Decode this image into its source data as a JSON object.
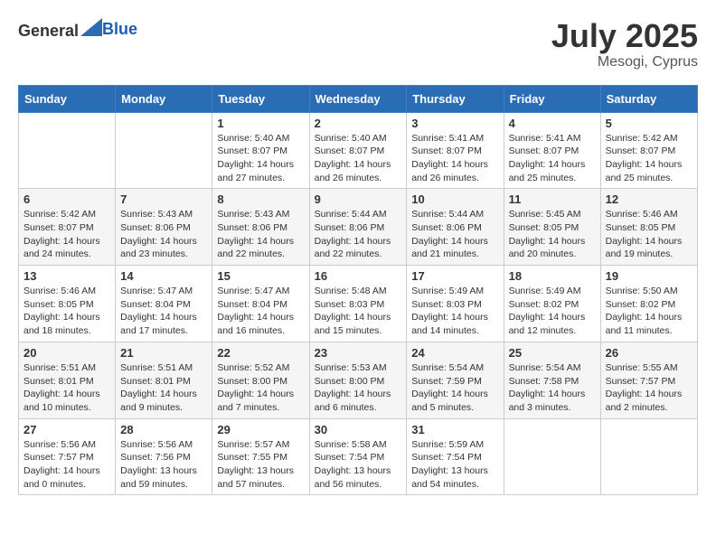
{
  "header": {
    "logo_general": "General",
    "logo_blue": "Blue",
    "month": "July 2025",
    "location": "Mesogi, Cyprus"
  },
  "days_of_week": [
    "Sunday",
    "Monday",
    "Tuesday",
    "Wednesday",
    "Thursday",
    "Friday",
    "Saturday"
  ],
  "weeks": [
    [
      {
        "day": "",
        "content": ""
      },
      {
        "day": "",
        "content": ""
      },
      {
        "day": "1",
        "content": "Sunrise: 5:40 AM\nSunset: 8:07 PM\nDaylight: 14 hours and 27 minutes."
      },
      {
        "day": "2",
        "content": "Sunrise: 5:40 AM\nSunset: 8:07 PM\nDaylight: 14 hours and 26 minutes."
      },
      {
        "day": "3",
        "content": "Sunrise: 5:41 AM\nSunset: 8:07 PM\nDaylight: 14 hours and 26 minutes."
      },
      {
        "day": "4",
        "content": "Sunrise: 5:41 AM\nSunset: 8:07 PM\nDaylight: 14 hours and 25 minutes."
      },
      {
        "day": "5",
        "content": "Sunrise: 5:42 AM\nSunset: 8:07 PM\nDaylight: 14 hours and 25 minutes."
      }
    ],
    [
      {
        "day": "6",
        "content": "Sunrise: 5:42 AM\nSunset: 8:07 PM\nDaylight: 14 hours and 24 minutes."
      },
      {
        "day": "7",
        "content": "Sunrise: 5:43 AM\nSunset: 8:06 PM\nDaylight: 14 hours and 23 minutes."
      },
      {
        "day": "8",
        "content": "Sunrise: 5:43 AM\nSunset: 8:06 PM\nDaylight: 14 hours and 22 minutes."
      },
      {
        "day": "9",
        "content": "Sunrise: 5:44 AM\nSunset: 8:06 PM\nDaylight: 14 hours and 22 minutes."
      },
      {
        "day": "10",
        "content": "Sunrise: 5:44 AM\nSunset: 8:06 PM\nDaylight: 14 hours and 21 minutes."
      },
      {
        "day": "11",
        "content": "Sunrise: 5:45 AM\nSunset: 8:05 PM\nDaylight: 14 hours and 20 minutes."
      },
      {
        "day": "12",
        "content": "Sunrise: 5:46 AM\nSunset: 8:05 PM\nDaylight: 14 hours and 19 minutes."
      }
    ],
    [
      {
        "day": "13",
        "content": "Sunrise: 5:46 AM\nSunset: 8:05 PM\nDaylight: 14 hours and 18 minutes."
      },
      {
        "day": "14",
        "content": "Sunrise: 5:47 AM\nSunset: 8:04 PM\nDaylight: 14 hours and 17 minutes."
      },
      {
        "day": "15",
        "content": "Sunrise: 5:47 AM\nSunset: 8:04 PM\nDaylight: 14 hours and 16 minutes."
      },
      {
        "day": "16",
        "content": "Sunrise: 5:48 AM\nSunset: 8:03 PM\nDaylight: 14 hours and 15 minutes."
      },
      {
        "day": "17",
        "content": "Sunrise: 5:49 AM\nSunset: 8:03 PM\nDaylight: 14 hours and 14 minutes."
      },
      {
        "day": "18",
        "content": "Sunrise: 5:49 AM\nSunset: 8:02 PM\nDaylight: 14 hours and 12 minutes."
      },
      {
        "day": "19",
        "content": "Sunrise: 5:50 AM\nSunset: 8:02 PM\nDaylight: 14 hours and 11 minutes."
      }
    ],
    [
      {
        "day": "20",
        "content": "Sunrise: 5:51 AM\nSunset: 8:01 PM\nDaylight: 14 hours and 10 minutes."
      },
      {
        "day": "21",
        "content": "Sunrise: 5:51 AM\nSunset: 8:01 PM\nDaylight: 14 hours and 9 minutes."
      },
      {
        "day": "22",
        "content": "Sunrise: 5:52 AM\nSunset: 8:00 PM\nDaylight: 14 hours and 7 minutes."
      },
      {
        "day": "23",
        "content": "Sunrise: 5:53 AM\nSunset: 8:00 PM\nDaylight: 14 hours and 6 minutes."
      },
      {
        "day": "24",
        "content": "Sunrise: 5:54 AM\nSunset: 7:59 PM\nDaylight: 14 hours and 5 minutes."
      },
      {
        "day": "25",
        "content": "Sunrise: 5:54 AM\nSunset: 7:58 PM\nDaylight: 14 hours and 3 minutes."
      },
      {
        "day": "26",
        "content": "Sunrise: 5:55 AM\nSunset: 7:57 PM\nDaylight: 14 hours and 2 minutes."
      }
    ],
    [
      {
        "day": "27",
        "content": "Sunrise: 5:56 AM\nSunset: 7:57 PM\nDaylight: 14 hours and 0 minutes."
      },
      {
        "day": "28",
        "content": "Sunrise: 5:56 AM\nSunset: 7:56 PM\nDaylight: 13 hours and 59 minutes."
      },
      {
        "day": "29",
        "content": "Sunrise: 5:57 AM\nSunset: 7:55 PM\nDaylight: 13 hours and 57 minutes."
      },
      {
        "day": "30",
        "content": "Sunrise: 5:58 AM\nSunset: 7:54 PM\nDaylight: 13 hours and 56 minutes."
      },
      {
        "day": "31",
        "content": "Sunrise: 5:59 AM\nSunset: 7:54 PM\nDaylight: 13 hours and 54 minutes."
      },
      {
        "day": "",
        "content": ""
      },
      {
        "day": "",
        "content": ""
      }
    ]
  ]
}
